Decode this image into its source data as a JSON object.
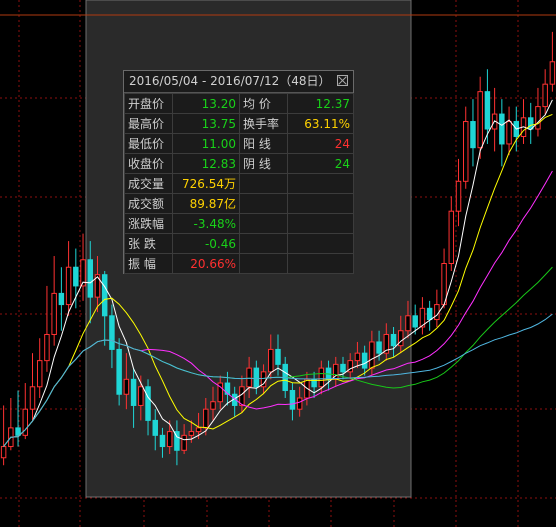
{
  "panel": {
    "title": "2016/05/04 - 2016/07/12（48日）",
    "rows": [
      {
        "l1": "开盘价",
        "v1": "13.20",
        "c1": "g",
        "l2": "均  价",
        "v2": "12.37",
        "c2": "g"
      },
      {
        "l1": "最高价",
        "v1": "13.75",
        "c1": "g",
        "l2": "换手率",
        "v2": "63.11%",
        "c2": "y"
      },
      {
        "l1": "最低价",
        "v1": "11.00",
        "c1": "g",
        "l2": "阳  线",
        "v2": "24",
        "c2": "r"
      },
      {
        "l1": "收盘价",
        "v1": "12.83",
        "c1": "g",
        "l2": "阴  线",
        "v2": "24",
        "c2": "g"
      },
      {
        "l1": "成交量",
        "v1": "726.54万",
        "c1": "y",
        "l2": "",
        "v2": "",
        "c2": ""
      },
      {
        "l1": "成交额",
        "v1": "89.87亿",
        "c1": "y",
        "l2": "",
        "v2": "",
        "c2": ""
      },
      {
        "l1": "涨跌幅",
        "v1": "-3.48%",
        "c1": "g",
        "l2": "",
        "v2": "",
        "c2": ""
      },
      {
        "l1": "张  跌",
        "v1": "-0.46",
        "c1": "g",
        "l2": "",
        "v2": "",
        "c2": ""
      },
      {
        "l1": "振  幅",
        "v1": "20.66%",
        "c1": "r",
        "l2": "",
        "v2": "",
        "c2": ""
      }
    ]
  },
  "colors": {
    "up": "#ff3232",
    "down": "#1fd6d6",
    "ma5": "#ffffff",
    "ma10": "#ffff00",
    "ma20": "#ff30ff",
    "ma60": "#19c819",
    "ma120": "#4fb6e0",
    "grid": "#8c1010",
    "selection_fill": "#2a2a2a",
    "selection_border": "#6e6e6e",
    "price_line": "#b03a10"
  },
  "chart_data": {
    "type": "candlestick",
    "price_range": [
      10.0,
      17.0
    ],
    "grid": true,
    "selection_range": [
      "2016/05/04",
      "2016/07/12"
    ],
    "candles": [
      [
        10.9,
        11.05,
        11.6,
        10.8
      ],
      [
        11.05,
        11.3,
        11.7,
        11.0
      ],
      [
        11.3,
        11.2,
        11.8,
        11.05
      ],
      [
        11.2,
        11.55,
        11.9,
        11.15
      ],
      [
        11.55,
        11.85,
        12.3,
        11.4
      ],
      [
        11.85,
        12.2,
        12.5,
        11.7
      ],
      [
        12.2,
        12.55,
        13.2,
        12.05
      ],
      [
        12.55,
        13.1,
        13.6,
        12.4
      ],
      [
        13.1,
        12.95,
        13.45,
        12.6
      ],
      [
        12.95,
        13.45,
        13.8,
        12.8
      ],
      [
        13.45,
        13.2,
        13.7,
        12.9
      ],
      [
        13.2,
        13.55,
        13.9,
        13.0
      ],
      [
        13.55,
        13.05,
        13.8,
        12.7
      ],
      [
        13.05,
        13.35,
        13.6,
        12.85
      ],
      [
        13.35,
        12.8,
        13.4,
        12.4
      ],
      [
        12.8,
        12.35,
        12.95,
        12.1
      ],
      [
        12.35,
        11.75,
        12.5,
        11.6
      ],
      [
        11.75,
        11.95,
        12.3,
        11.55
      ],
      [
        11.95,
        11.6,
        12.1,
        11.3
      ],
      [
        11.6,
        11.85,
        12.0,
        11.4
      ],
      [
        11.85,
        11.4,
        11.95,
        11.2
      ],
      [
        11.4,
        11.2,
        11.55,
        11.0
      ],
      [
        11.2,
        11.05,
        11.3,
        10.9
      ],
      [
        11.05,
        11.25,
        11.4,
        10.95
      ],
      [
        11.25,
        11.0,
        11.4,
        10.8
      ],
      [
        11.0,
        11.2,
        11.35,
        10.95
      ],
      [
        11.2,
        11.25,
        11.4,
        11.1
      ],
      [
        11.25,
        11.3,
        11.5,
        11.15
      ],
      [
        11.3,
        11.55,
        11.7,
        11.2
      ],
      [
        11.55,
        11.65,
        11.85,
        11.4
      ],
      [
        11.65,
        11.9,
        12.0,
        11.55
      ],
      [
        11.9,
        11.75,
        12.05,
        11.6
      ],
      [
        11.75,
        11.6,
        11.85,
        11.45
      ],
      [
        11.6,
        11.85,
        12.0,
        11.5
      ],
      [
        11.85,
        12.1,
        12.25,
        11.7
      ],
      [
        12.1,
        11.85,
        12.2,
        11.75
      ],
      [
        11.85,
        12.05,
        12.15,
        11.75
      ],
      [
        12.05,
        12.35,
        12.55,
        11.95
      ],
      [
        12.35,
        12.15,
        12.55,
        12.0
      ],
      [
        12.15,
        11.8,
        12.25,
        11.7
      ],
      [
        11.8,
        11.55,
        11.9,
        11.4
      ],
      [
        11.55,
        11.7,
        11.85,
        11.45
      ],
      [
        11.7,
        11.95,
        12.05,
        11.6
      ],
      [
        11.95,
        11.85,
        12.05,
        11.7
      ],
      [
        11.85,
        12.1,
        12.2,
        11.75
      ],
      [
        12.1,
        11.95,
        12.2,
        11.8
      ],
      [
        11.95,
        12.15,
        12.25,
        11.85
      ],
      [
        12.15,
        12.05,
        12.25,
        11.95
      ],
      [
        12.05,
        12.2,
        12.3,
        11.95
      ],
      [
        12.2,
        12.3,
        12.45,
        12.1
      ],
      [
        12.3,
        12.1,
        12.4,
        12.0
      ],
      [
        12.1,
        12.45,
        12.6,
        12.0
      ],
      [
        12.45,
        12.3,
        12.6,
        12.2
      ],
      [
        12.3,
        12.55,
        12.7,
        12.2
      ],
      [
        12.55,
        12.4,
        12.65,
        12.25
      ],
      [
        12.4,
        12.6,
        12.8,
        12.3
      ],
      [
        12.6,
        12.8,
        13.0,
        12.5
      ],
      [
        12.8,
        12.65,
        12.95,
        12.55
      ],
      [
        12.65,
        12.9,
        13.05,
        12.55
      ],
      [
        12.9,
        12.75,
        13.0,
        12.6
      ],
      [
        12.75,
        12.95,
        13.15,
        12.65
      ],
      [
        12.95,
        13.5,
        13.7,
        12.9
      ],
      [
        13.5,
        14.2,
        14.4,
        13.4
      ],
      [
        14.2,
        14.6,
        14.9,
        14.0
      ],
      [
        14.6,
        15.4,
        15.6,
        14.5
      ],
      [
        15.4,
        15.05,
        15.7,
        14.8
      ],
      [
        15.05,
        15.8,
        16.0,
        14.9
      ],
      [
        15.8,
        15.3,
        16.1,
        15.1
      ],
      [
        15.3,
        15.5,
        15.85,
        15.0
      ],
      [
        15.5,
        15.1,
        15.7,
        14.8
      ],
      [
        15.1,
        15.4,
        15.6,
        14.95
      ],
      [
        15.4,
        15.2,
        15.6,
        15.0
      ],
      [
        15.2,
        15.45,
        15.7,
        15.1
      ],
      [
        15.45,
        15.3,
        15.65,
        15.1
      ],
      [
        15.3,
        15.6,
        15.85,
        15.2
      ],
      [
        15.6,
        15.9,
        16.1,
        15.5
      ],
      [
        15.9,
        16.2,
        16.6,
        15.8
      ]
    ]
  }
}
